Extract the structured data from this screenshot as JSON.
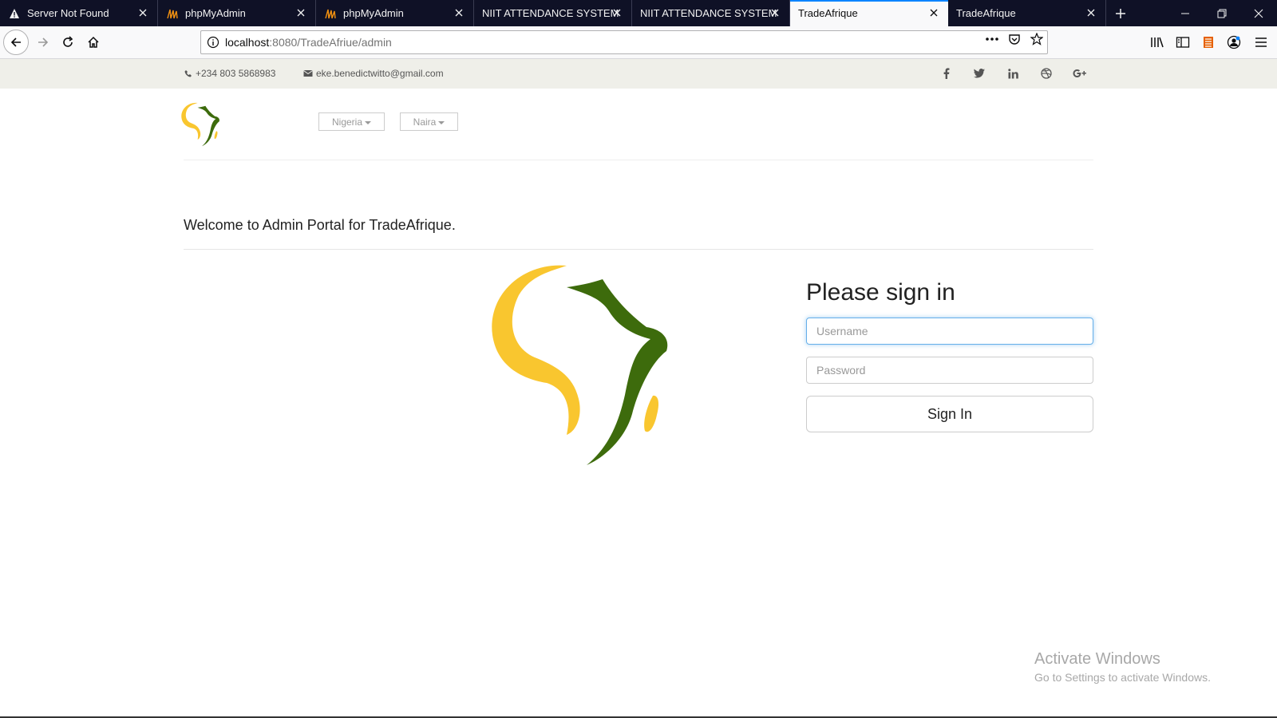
{
  "browser": {
    "tabs": [
      {
        "title": "Server Not Found",
        "icon": "warning-icon"
      },
      {
        "title": "phpMyAdmin",
        "icon": "phpmyadmin-icon"
      },
      {
        "title": "phpMyAdmin",
        "icon": "phpmyadmin-icon"
      },
      {
        "title": "NIIT ATTENDANCE SYSTEM",
        "icon": ""
      },
      {
        "title": "NIIT ATTENDANCE SYSTEM",
        "icon": ""
      },
      {
        "title": "TradeAfrique",
        "icon": "",
        "active": true
      },
      {
        "title": "TradeAfrique",
        "icon": ""
      }
    ],
    "url_host": "localhost",
    "url_rest": ":8080/TradeAfriue/admin",
    "accent": "#0a84ff"
  },
  "contact": {
    "phone": "+234 803 5868983",
    "email": "eke.benedictwitto@gmail.com",
    "social": [
      "facebook-icon",
      "twitter-icon",
      "linkedin-icon",
      "dribbble-icon",
      "google-plus-icon"
    ]
  },
  "header": {
    "country": "Nigeria",
    "currency": "Naira"
  },
  "main": {
    "welcome": "Welcome to Admin Portal for TradeAfrique.",
    "signin_title": "Please sign in",
    "username_placeholder": "Username",
    "password_placeholder": "Password",
    "signin_label": "Sign In"
  },
  "colors": {
    "logo_yellow": "#f9c62f",
    "logo_green": "#3d6b0c"
  },
  "watermark": {
    "title": "Activate Windows",
    "subtitle": "Go to Settings to activate Windows."
  }
}
